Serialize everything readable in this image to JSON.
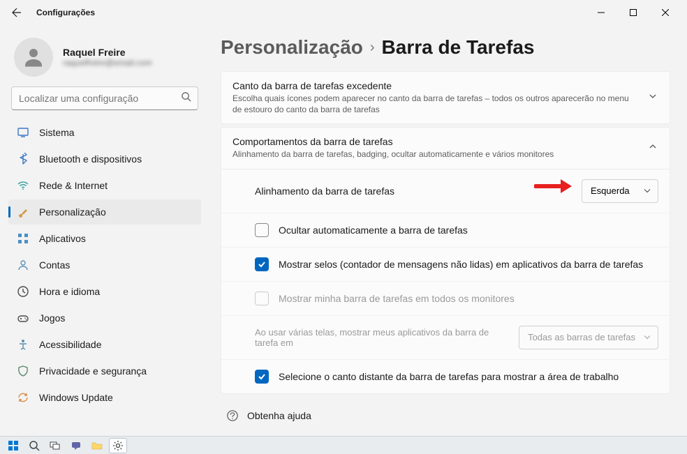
{
  "window": {
    "title": "Configurações"
  },
  "user": {
    "name": "Raquel Freire",
    "email": "raquelfreire@email.com"
  },
  "search": {
    "placeholder": "Localizar uma configuração"
  },
  "nav": [
    {
      "icon": "system",
      "label": "Sistema",
      "color": "#3b78c4"
    },
    {
      "icon": "bluetooth",
      "label": "Bluetooth e dispositivos",
      "color": "#3b78c4"
    },
    {
      "icon": "wifi",
      "label": "Rede & Internet",
      "color": "#3ea3a3"
    },
    {
      "icon": "brush",
      "label": "Personalização",
      "color": "#d29a4f",
      "selected": true
    },
    {
      "icon": "apps",
      "label": "Aplicativos",
      "color": "#4b8fc5"
    },
    {
      "icon": "user",
      "label": "Contas",
      "color": "#5c93b8"
    },
    {
      "icon": "clock",
      "label": "Hora e idioma",
      "color": "#4a4a4a"
    },
    {
      "icon": "game",
      "label": "Jogos",
      "color": "#4a4a4a"
    },
    {
      "icon": "access",
      "label": "Acessibilidade",
      "color": "#5c8fb0"
    },
    {
      "icon": "shield",
      "label": "Privacidade e segurança",
      "color": "#5a8a6e"
    },
    {
      "icon": "update",
      "label": "Windows Update",
      "color": "#d88a3f"
    }
  ],
  "breadcrumb": {
    "parent": "Personalização",
    "current": "Barra de Tarefas"
  },
  "cards": {
    "overflow": {
      "title": "Canto da barra de tarefas excedente",
      "sub": "Escolha quais ícones podem aparecer no canto da barra de tarefas – todos os outros aparecerão no menu de estouro do canto da barra de tarefas"
    },
    "behaviors": {
      "title": "Comportamentos da barra de tarefas",
      "sub": "Alinhamento da barra de tarefas, badging, ocultar automaticamente e vários monitores"
    }
  },
  "options": {
    "alignment": {
      "label": "Alinhamento da barra de tarefas",
      "value": "Esquerda"
    },
    "autohide": {
      "label": "Ocultar automaticamente a barra de tarefas",
      "checked": false
    },
    "badges": {
      "label": "Mostrar selos (contador de mensagens não lidas) em aplicativos da barra de tarefas",
      "checked": true
    },
    "allmonitors": {
      "label": "Mostrar minha barra de tarefas em todos os monitores",
      "checked": false,
      "disabled": true
    },
    "multiscreen": {
      "label": "Ao usar várias telas, mostrar meus aplicativos da barra de tarefa em",
      "value": "Todas as barras de tarefas",
      "disabled": true
    },
    "farcorner": {
      "label": "Selecione o canto distante da barra de tarefas para mostrar a área de trabalho",
      "checked": true
    }
  },
  "help": {
    "label": "Obtenha ajuda"
  }
}
